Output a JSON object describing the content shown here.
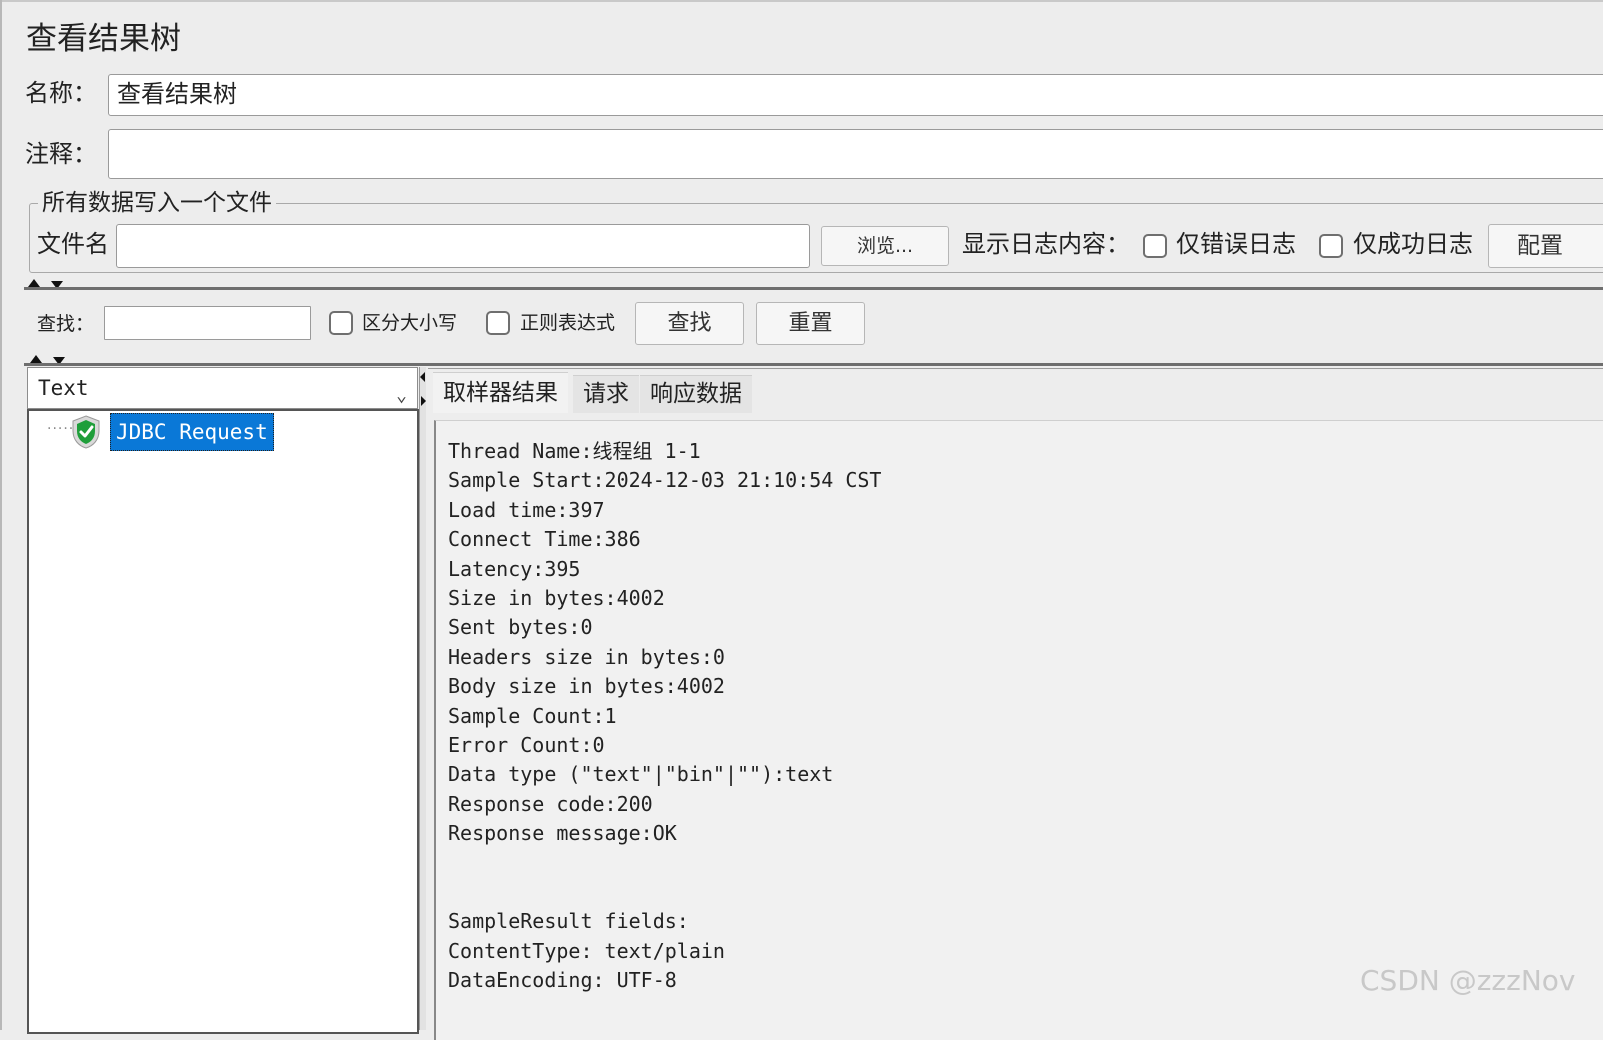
{
  "panel": {
    "title": "查看结果树",
    "name_label": "名称：",
    "name_value": "查看结果树",
    "comment_label": "注释：",
    "comment_value": ""
  },
  "file_group": {
    "legend": "所有数据写入一个文件",
    "filename_label": "文件名",
    "filename_value": "",
    "browse_label": "浏览...",
    "log_display_label": "显示日志内容：",
    "errors_only_label": "仅错误日志",
    "errors_only_checked": false,
    "success_only_label": "仅成功日志",
    "success_only_checked": false,
    "configure_label": "配置"
  },
  "search": {
    "label": "查找：",
    "value": "",
    "case_sensitive_label": "区分大小写",
    "case_sensitive_checked": false,
    "regex_label": "正则表达式",
    "regex_checked": false,
    "find_button": "查找",
    "reset_button": "重置"
  },
  "renderer": {
    "selected": "Text"
  },
  "tree": {
    "items": [
      {
        "label": "JDBC Request",
        "status": "success",
        "selected": true
      }
    ]
  },
  "tabs": [
    {
      "label": "取样器结果",
      "active": true
    },
    {
      "label": "请求",
      "active": false
    },
    {
      "label": "响应数据",
      "active": false
    }
  ],
  "sampler_result": {
    "lines": [
      "Thread Name:线程组 1-1",
      "Sample Start:2024-12-03 21:10:54 CST",
      "Load time:397",
      "Connect Time:386",
      "Latency:395",
      "Size in bytes:4002",
      "Sent bytes:0",
      "Headers size in bytes:0",
      "Body size in bytes:4002",
      "Sample Count:1",
      "Error Count:0",
      "Data type (\"text\"|\"bin\"|\"\"):text",
      "Response code:200",
      "Response message:OK",
      "",
      "",
      "SampleResult fields:",
      "ContentType: text/plain",
      "DataEncoding: UTF-8"
    ]
  },
  "watermark": "CSDN @zzzNov",
  "colors": {
    "selection": "#0a78d7",
    "success_icon": "#1f9e3a",
    "window_bg": "#ededed"
  }
}
